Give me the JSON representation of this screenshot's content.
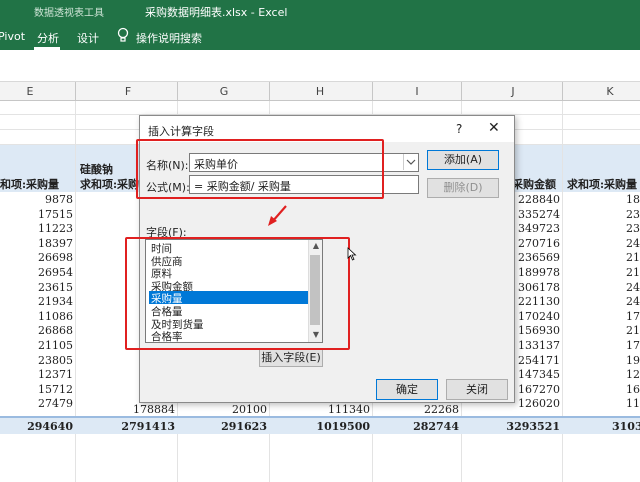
{
  "ribbon": {
    "context_label": "数据透视表工具",
    "window_title": "采购数据明细表.xlsx  -  Excel",
    "tabs": [
      "Pivot",
      "分析",
      "设计"
    ],
    "tell_me": "操作说明搜索",
    "accent": "#217346"
  },
  "columns": [
    "E",
    "F",
    "G",
    "H",
    "I",
    "J",
    "K"
  ],
  "sheet": {
    "header_F_top": "硅酸钠",
    "header_E": "和项:采购量",
    "header_F": "求和项:采购量",
    "header_J": "采购金额",
    "header_K": "求和项:采购量",
    "col_E": [
      "9878",
      "17515",
      "11223",
      "18397",
      "26698",
      "26954",
      "23615",
      "21934",
      "11086",
      "26868",
      "21105",
      "23805",
      "12371",
      "15712",
      "27479"
    ],
    "col_J": [
      "228840",
      "335274",
      "349723",
      "270716",
      "236569",
      "189978",
      "306178",
      "221130",
      "170240",
      "156930",
      "133137",
      "254171",
      "147345",
      "167270",
      "126020"
    ],
    "col_K": [
      "180",
      "233",
      "238",
      "241",
      "210",
      "219",
      "249",
      "247",
      "170",
      "217",
      "170",
      "191",
      "126",
      "160",
      "112"
    ],
    "last_row": {
      "F": "178884",
      "G": "20100",
      "H": "111340",
      "I": "22268"
    },
    "totals": {
      "E": "294640",
      "F": "2791413",
      "G": "291623",
      "H": "1019500",
      "I": "282744",
      "J": "3293521",
      "K": "3103"
    },
    "band_color": "#dde9f5"
  },
  "dialog": {
    "title": "插入计算字段",
    "help": "?",
    "close": "✕",
    "name_label": "名称(N):",
    "name_value": "采购单价",
    "formula_label": "公式(M):",
    "formula_value": "= 采购金额/ 采购量",
    "add_button": "添加(A)",
    "delete_button": "删除(D)",
    "fields_label": "字段(F):",
    "fields": [
      "时间",
      "供应商",
      "原料",
      "采购金额",
      "采购量",
      "合格量",
      "及时到货量",
      "合格率"
    ],
    "selected_field": "采购量",
    "insert_field_button": "插入字段(E)",
    "ok_button": "确定",
    "close_button": "关闭"
  }
}
